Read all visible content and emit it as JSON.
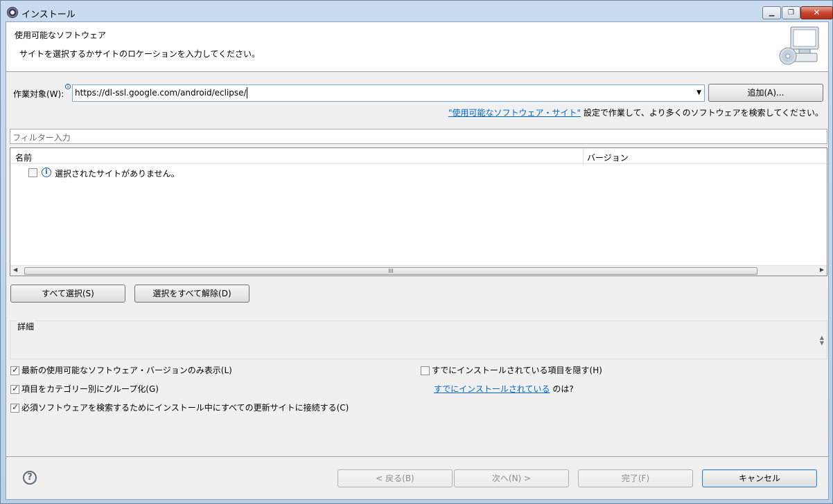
{
  "window": {
    "title": "インストール",
    "minimize": "▁",
    "restore": "❐",
    "close": "✕"
  },
  "header": {
    "title": "使用可能なソフトウェア",
    "description": "サイトを選択するかサイトのロケーションを入力してください。"
  },
  "work_with": {
    "label": "作業対象(W):",
    "value": "https://dl-ssl.google.com/android/eclipse/",
    "add_button": "追加(A)...",
    "link_text": "\"使用可能なソフトウェア・サイト\"",
    "link_suffix": "設定で作業して、より多くのソフトウェアを検索してください。"
  },
  "filter": {
    "placeholder": "フィルター入力"
  },
  "table": {
    "columns": [
      "名前",
      "バージョン"
    ],
    "rows": [
      {
        "text": "選択されたサイトがありません。",
        "checked": false
      }
    ],
    "scroll_grip": "III"
  },
  "selection": {
    "select_all": "すべて選択(S)",
    "deselect_all": "選択をすべて解除(D)"
  },
  "details": {
    "label": "詳細"
  },
  "options": {
    "latest_only": {
      "label": "最新の使用可能なソフトウェア・バージョンのみ表示(L)",
      "checked": true
    },
    "group_by_category": {
      "label": "項目をカテゴリー別にグループ化(G)",
      "checked": true
    },
    "contact_all_sites": {
      "label": "必須ソフトウェアを検索するためにインストール中にすべての更新サイトに接続する(C)",
      "checked": true
    },
    "hide_installed": {
      "label": "すでにインストールされている項目を隠す(H)",
      "checked": false
    },
    "already_installed_link": "すでにインストールされている",
    "already_installed_suffix": "のは?"
  },
  "footer": {
    "back": "< 戻る(B)",
    "next": "次へ(N) >",
    "finish": "完了(F)",
    "cancel": "キャンセル"
  },
  "icons": {
    "help": "?",
    "info": "i"
  }
}
